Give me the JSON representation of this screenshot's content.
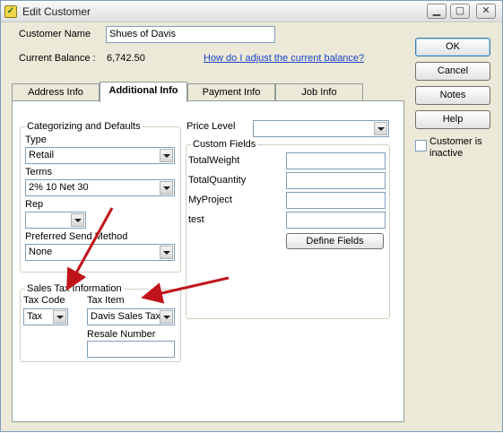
{
  "window": {
    "title": "Edit Customer"
  },
  "header": {
    "customer_name_label": "Customer Name",
    "customer_name_value": "Shues of Davis",
    "current_balance_label": "Current Balance :",
    "current_balance_value": "6,742.50",
    "adjust_link": "How do I adjust the current balance?"
  },
  "tabs": [
    {
      "label": "Address Info"
    },
    {
      "label": "Additional Info"
    },
    {
      "label": "Payment Info"
    },
    {
      "label": "Job Info"
    }
  ],
  "categorizing": {
    "title": "Categorizing and Defaults",
    "type_label": "Type",
    "type_value": "Retail",
    "terms_label": "Terms",
    "terms_value": "2% 10 Net 30",
    "rep_label": "Rep",
    "rep_value": "",
    "send_method_label": "Preferred Send Method",
    "send_method_value": "None"
  },
  "price_level": {
    "label": "Price Level",
    "value": ""
  },
  "custom_fields": {
    "title": "Custom Fields",
    "fields": [
      {
        "label": "TotalWeight",
        "value": ""
      },
      {
        "label": "TotalQuantity",
        "value": ""
      },
      {
        "label": "MyProject",
        "value": ""
      },
      {
        "label": "test",
        "value": ""
      }
    ],
    "define_button": "Define Fields"
  },
  "sales_tax": {
    "title": "Sales Tax Information",
    "tax_code_label": "Tax Code",
    "tax_code_value": "Tax",
    "tax_item_label": "Tax Item",
    "tax_item_value": "Davis Sales Tax",
    "resale_label": "Resale Number",
    "resale_value": ""
  },
  "side_buttons": {
    "ok": "OK",
    "cancel": "Cancel",
    "notes": "Notes",
    "help": "Help"
  },
  "inactive": {
    "label": "Customer is inactive",
    "checked": false
  },
  "colors": {
    "annotation_arrow": "#c0141a",
    "link": "#1a44c8"
  }
}
